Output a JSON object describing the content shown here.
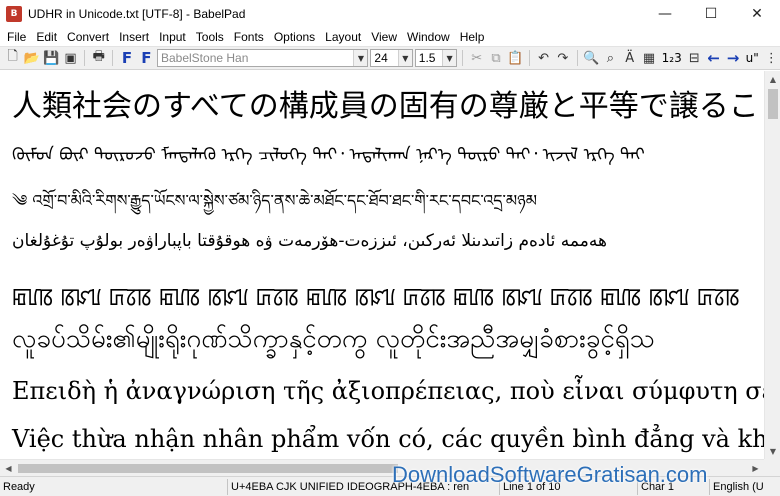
{
  "window": {
    "title": "UDHR in Unicode.txt [UTF-8] - BabelPad",
    "app_icon_text": "B",
    "minimize": "—",
    "maximize": "☐",
    "close": "✕"
  },
  "menu": [
    "File",
    "Edit",
    "Convert",
    "Insert",
    "Input",
    "Tools",
    "Fonts",
    "Options",
    "Layout",
    "View",
    "Window",
    "Help"
  ],
  "toolbar": {
    "font_name": "BabelStone Han",
    "font_size": "24",
    "line_spacing": "1.5",
    "bold_label": "F",
    "italic_label": "F",
    "numbering_label": "1₂3",
    "direction_label": "u\"",
    "accent_color": "#1a3fb4"
  },
  "editor": {
    "lines": [
      "人類社会のすべての構成員の固有の尊厳と平等で譲ることの",
      "ᠬᠦᠮᠦᠨ ᠪᠦᠷ ᠲᠥᠷᠥᠵᠦ ᠮᠡᠨᠳᠡᠯᠡᠬᠦ ᠡᠷᠬᠡ ᠴᠢᠯᠦᠭᠡ ᠲᠡᠢ᠂ ᠠᠳᠠᠯᠢᠬᠠᠨ ᠨᠡᠷ᠎ᠡ ᠲᠥᠷᠥ ᠲᠡᠢ᠂ ᠢᠵᠢᠯ ᠡᠷᠬᠡ ᠲᠡᠢ",
      "༄ འགྲོ་བ་མིའི་རིགས་རྒྱུད་ཡོངས་ལ་སྐྱེས་ཙམ་ཉིད་ནས་ཆེ་མཐོང་དང་ཐོབ་ཐང་གི་རང་དབང་འདྲ་མཉམ",
      "ھەممە ئادەم زاتىدىنلا ئەركىن، ئىززەت-ھۆرمەت ۋە ھوقۇقتا باپباراۋەر بولۇپ تۇغۇلغان",
      "ꡂꡦꡋ ꡋꡜꡦ ꡚꡞꡋ ꡂꡦꡋ ꡋꡜꡦ ꡚꡞꡋ ꡂꡦꡋ ꡋꡜꡦ ꡚꡞꡋ ꡂꡦꡋ ꡋꡜꡦ ꡚꡞꡋ ꡂꡦꡋ ꡋꡜꡦ ꡚꡞꡋ",
      "လူခပ်သိမ်း၏မျိုးရိုးဂုဏ်သိက္ခာနှင့်တကွ လူတိုင်းအညီအမျှခံစားခွင့်ရှိသ",
      "Επειδὴ ἡ ἀναγνώριση τῆς ἀξιοπρέπειας, ποὺ εἶναι σύμφυτη σὲ",
      "Việc thừa nhận nhân phẩm vốn có, các quyền bình đẳng và khô"
    ]
  },
  "statusbar": {
    "ready": "Ready",
    "char_info": "U+4EBA CJK UNIFIED IDEOGRAPH-4EBA : ren",
    "line_info": "Line 1 of 10",
    "col_info": "Char 1",
    "lang_info": "English (U"
  },
  "watermark": "DownloadSoftwareGratisan.com"
}
